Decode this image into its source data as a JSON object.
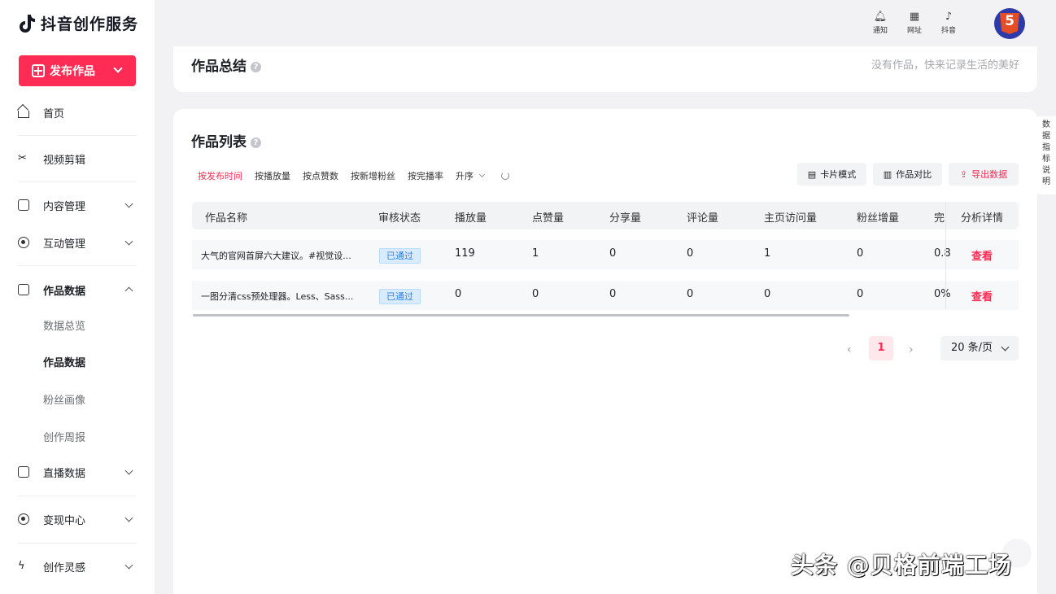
{
  "app": {
    "title": "抖音创作服务"
  },
  "sidebar": {
    "publish_label": "发布作品",
    "items": [
      {
        "label": "首页"
      },
      {
        "label": "视频剪辑"
      },
      {
        "label": "内容管理"
      },
      {
        "label": "互动管理"
      },
      {
        "label": "作品数据"
      },
      {
        "label": "直播数据"
      },
      {
        "label": "变现中心"
      },
      {
        "label": "创作灵感"
      }
    ],
    "sub_items": [
      {
        "label": "数据总览"
      },
      {
        "label": "作品数据"
      },
      {
        "label": "粉丝画像"
      },
      {
        "label": "创作周报"
      }
    ]
  },
  "header": {
    "icons": [
      {
        "label": "通知",
        "icon": "bell-icon"
      },
      {
        "label": "网址",
        "icon": "grid-icon"
      },
      {
        "label": "抖音",
        "icon": "tiktok-icon"
      }
    ]
  },
  "summary": {
    "title": "作品总结",
    "empty_text": "没有作品，快来记录生活的美好"
  },
  "works": {
    "title": "作品列表",
    "filters": [
      "按发布时间",
      "按播放量",
      "按点赞数",
      "按新增粉丝",
      "按完播率"
    ],
    "order": "升序",
    "buttons": {
      "card_mode": "卡片模式",
      "compare": "作品对比",
      "export": "导出数据"
    },
    "columns": [
      "作品名称",
      "审核状态",
      "播放量",
      "点赞量",
      "分享量",
      "评论量",
      "主页访问量",
      "粉丝增量",
      "完",
      "分析详情"
    ],
    "rows": [
      {
        "name": "大气的官网首屏六大建议。#视觉设...",
        "status": "已通过",
        "plays": "119",
        "likes": "1",
        "shares": "0",
        "comments": "0",
        "visits": "1",
        "fans": "0",
        "completion": "0.8",
        "action": "查看"
      },
      {
        "name": "一图分清css预处理器。Less、Sass...",
        "status": "已通过",
        "plays": "0",
        "likes": "0",
        "shares": "0",
        "comments": "0",
        "visits": "0",
        "fans": "0",
        "completion": "0%",
        "action": "查看"
      }
    ]
  },
  "pagination": {
    "current": "1",
    "page_size": "20 条/页"
  },
  "side_tab": "数据指标说明",
  "watermark": "头条 @贝格前端工场",
  "colors": {
    "brand": "#fe2c55",
    "badge_bg": "#d8ecfe",
    "badge_text": "#2d7fe0"
  }
}
